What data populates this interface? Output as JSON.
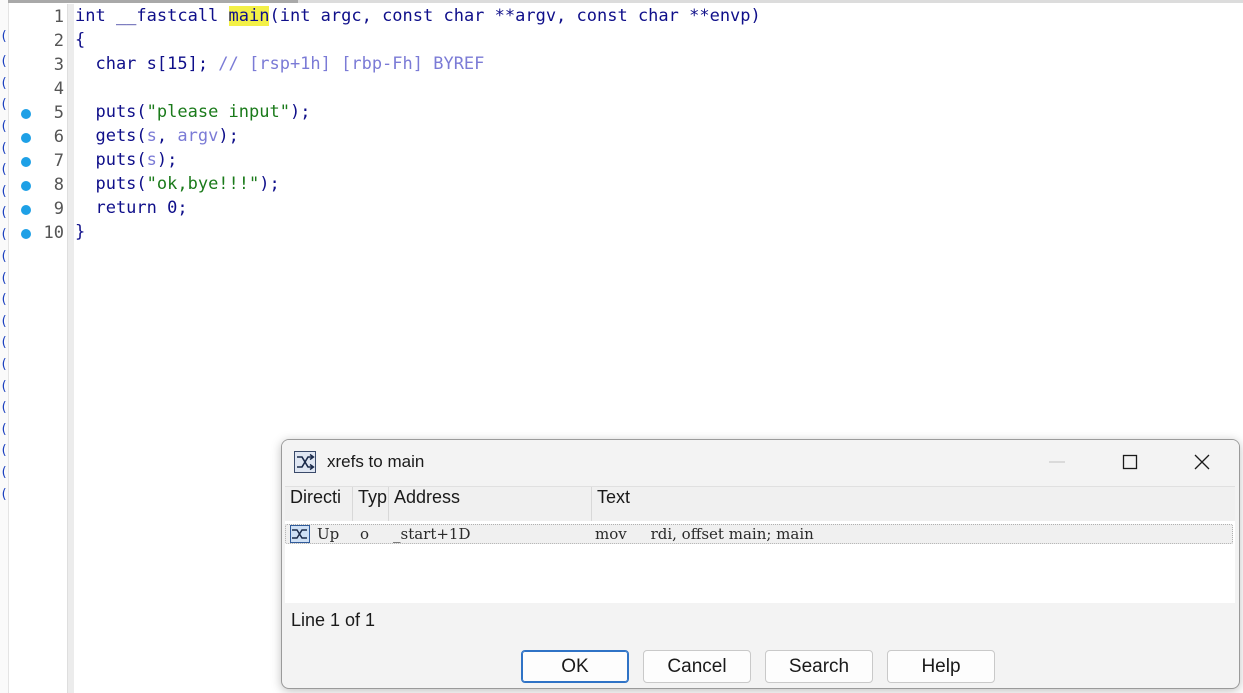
{
  "editor": {
    "lines": [
      {
        "num": "1",
        "bp": false,
        "tokens": [
          {
            "t": "int __fastcall ",
            "c": "kw"
          },
          {
            "t": "main",
            "c": "hl"
          },
          {
            "t": "(int argc, const char **argv, const char **envp)",
            "c": "kw"
          }
        ]
      },
      {
        "num": "2",
        "bp": false,
        "tokens": [
          {
            "t": "{",
            "c": "kw"
          }
        ]
      },
      {
        "num": "3",
        "bp": false,
        "tokens": [
          {
            "t": "  char s[15]; ",
            "c": "kw"
          },
          {
            "t": "// [rsp+1h] [rbp-Fh] BYREF",
            "c": "cmt"
          }
        ]
      },
      {
        "num": "4",
        "bp": false,
        "tokens": []
      },
      {
        "num": "5",
        "bp": true,
        "tokens": [
          {
            "t": "  puts(",
            "c": "kw"
          },
          {
            "t": "\"please input\"",
            "c": "str"
          },
          {
            "t": ");",
            "c": "kw"
          }
        ]
      },
      {
        "num": "6",
        "bp": true,
        "tokens": [
          {
            "t": "  gets(",
            "c": "kw"
          },
          {
            "t": "s",
            "c": "var"
          },
          {
            "t": ", ",
            "c": "kw"
          },
          {
            "t": "argv",
            "c": "var"
          },
          {
            "t": ");",
            "c": "kw"
          }
        ]
      },
      {
        "num": "7",
        "bp": true,
        "tokens": [
          {
            "t": "  puts(",
            "c": "kw"
          },
          {
            "t": "s",
            "c": "var"
          },
          {
            "t": ");",
            "c": "kw"
          }
        ]
      },
      {
        "num": "8",
        "bp": true,
        "tokens": [
          {
            "t": "  puts(",
            "c": "kw"
          },
          {
            "t": "\"ok,bye!!!\"",
            "c": "str"
          },
          {
            "t": ");",
            "c": "kw"
          }
        ]
      },
      {
        "num": "9",
        "bp": true,
        "tokens": [
          {
            "t": "  return 0;",
            "c": "kw"
          }
        ]
      },
      {
        "num": "10",
        "bp": true,
        "tokens": [
          {
            "t": "}",
            "c": "kw"
          }
        ]
      }
    ]
  },
  "dialog": {
    "title": "xrefs to main",
    "columns": [
      "Directi",
      "Typ",
      "Address",
      "Text"
    ],
    "rows": [
      {
        "direction": "Up",
        "type": "o",
        "address": "_start+1D",
        "text": "mov     rdi, offset main; main"
      }
    ],
    "status": "Line 1 of 1",
    "buttons": {
      "ok": "OK",
      "cancel": "Cancel",
      "search": "Search",
      "help": "Help"
    }
  },
  "colors": {
    "breakpoint": "#1ea0e6",
    "highlight": "#f3f047",
    "code": "#0f0f8a",
    "comment": "#7b7bd6",
    "string": "#1a7a1a",
    "focus_border": "#2f73c6"
  },
  "icons": {
    "dialog": "xref-icon",
    "row": "xref-icon"
  }
}
